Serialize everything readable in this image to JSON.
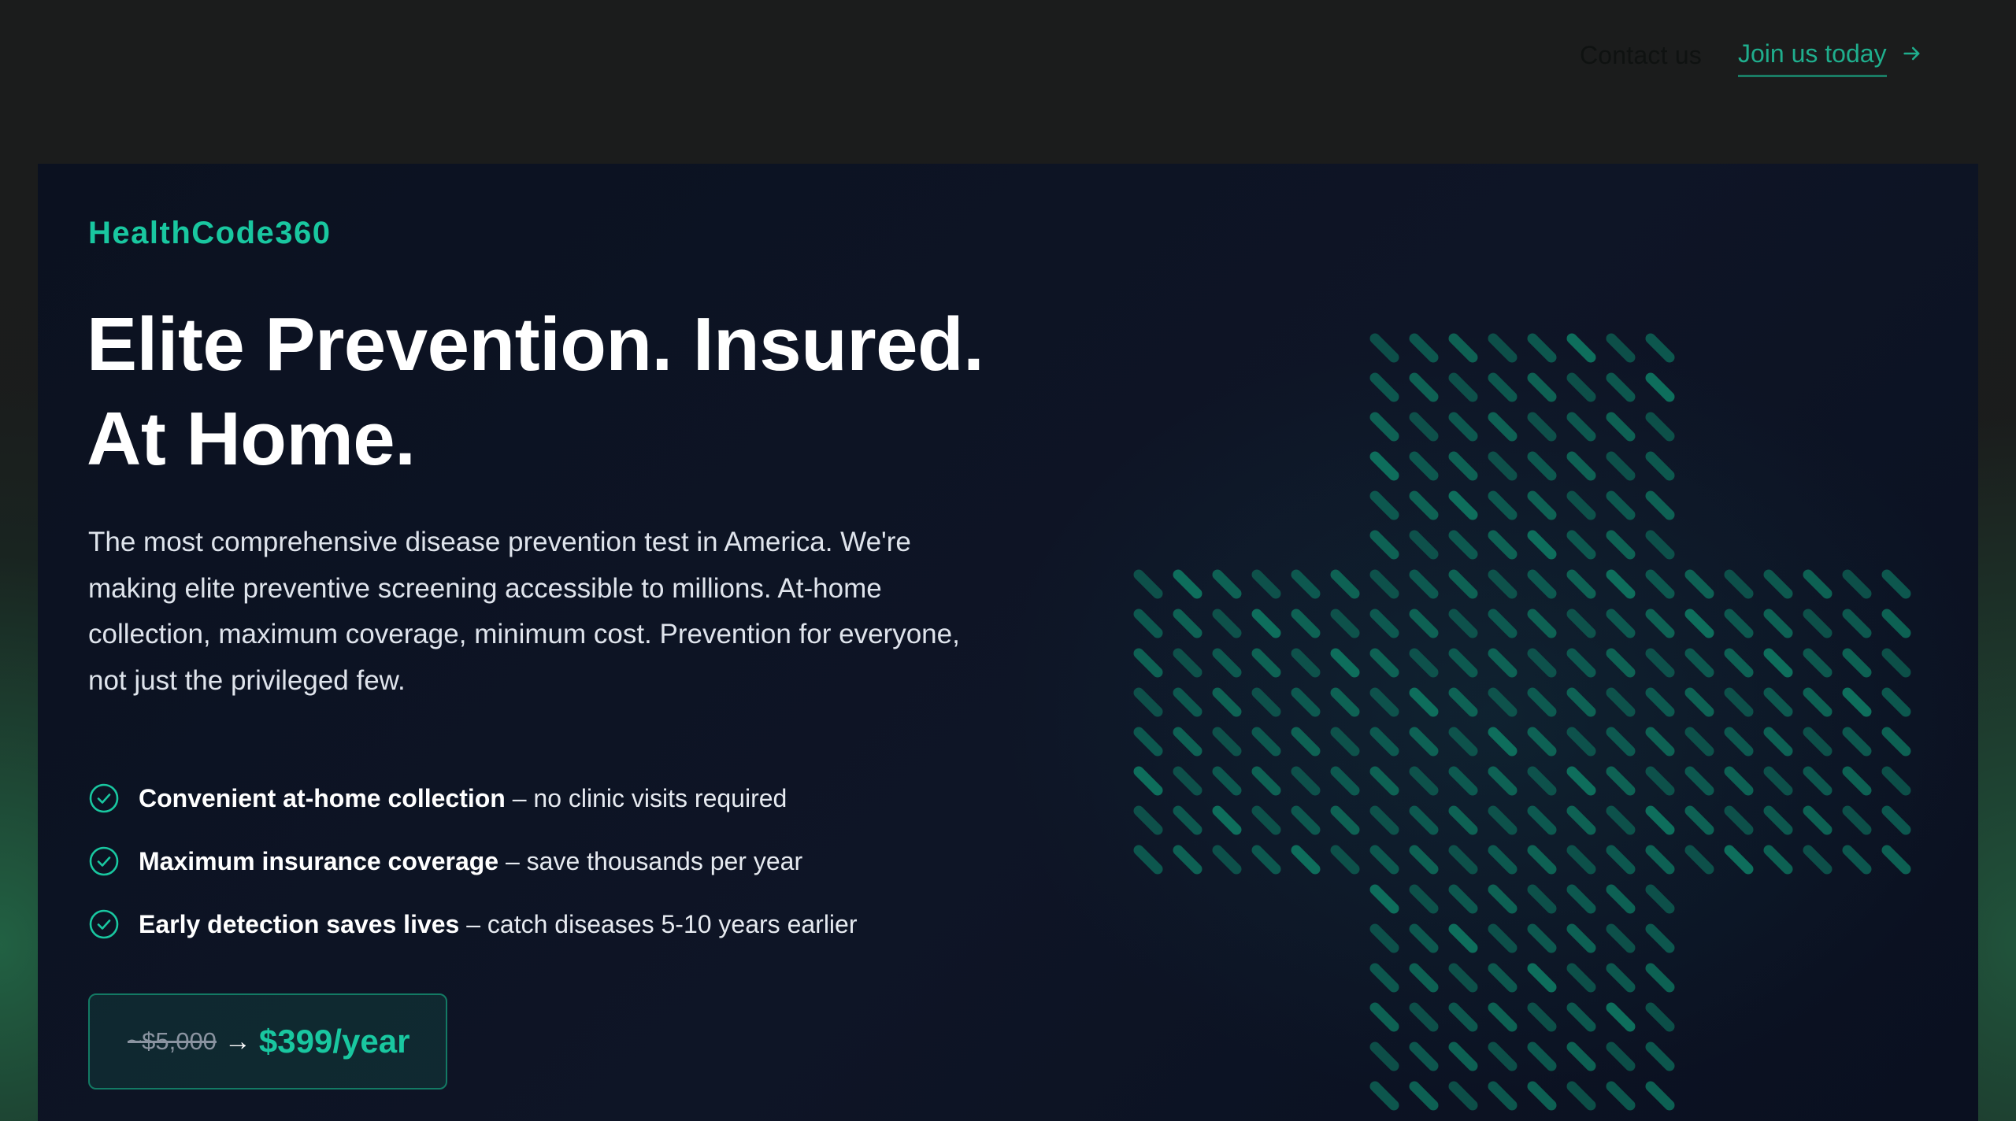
{
  "nav": {
    "contact_label": "Contact us",
    "join_label": "Join us today"
  },
  "hero": {
    "brand": "HealthCode360",
    "headline_line1": "Elite Prevention. Insured.",
    "headline_line2": "At Home.",
    "description": "The most comprehensive disease prevention test in America. We're making elite preventive screening accessible to millions. At-home collection, maximum coverage, minimum cost. Prevention for everyone, not just the privileged few.",
    "features": [
      {
        "bold": "Convenient at-home collection",
        "rest": " – no clinic visits required"
      },
      {
        "bold": "Maximum insurance coverage",
        "rest": " – save thousands per year"
      },
      {
        "bold": "Early detection saves lives",
        "rest": " – catch diseases 5-10 years earlier"
      }
    ],
    "price": {
      "old": "~$5,000",
      "arrow": "→",
      "new": "$399/year"
    }
  },
  "icons": {
    "nav_join": "arrow-right-icon",
    "feature": "circle-check-icon",
    "hero_art": "medical-cross-icon"
  },
  "colors": {
    "accent": "#19c7a0",
    "hero_bg": "#0b1120",
    "page_bg": "#1a1c1c",
    "cross_dash": "#0e6e5c"
  }
}
